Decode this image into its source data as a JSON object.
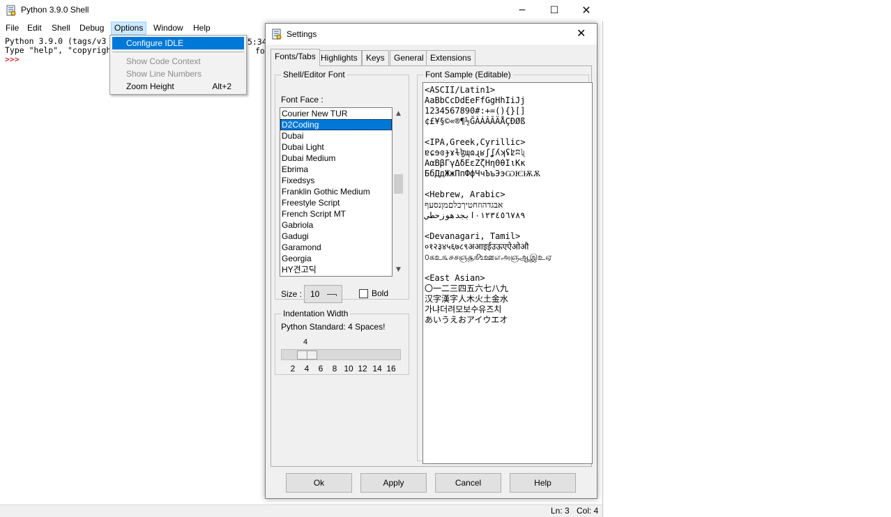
{
  "shell": {
    "title": "Python 3.9.0 Shell",
    "controls": {
      "minimize": "─",
      "maximize": "☐",
      "close": "✕"
    },
    "menu": [
      "File",
      "Edit",
      "Shell",
      "Debug",
      "Options",
      "Window",
      "Help"
    ],
    "text_line1": "Python 3.9.0 (tags/v3",
    "text_line1_tail": "5:34",
    "text_line2": "Type \"help\", \"copyrigh",
    "text_line2_tail": "fo",
    "prompt": ">>>",
    "options_menu": {
      "items": [
        "Configure IDLE",
        "Show Code Context",
        "Show Line Numbers",
        "Zoom Height"
      ],
      "zoom_accel": "Alt+2"
    },
    "status": {
      "ln": "Ln: 3",
      "col": "Col: 4"
    }
  },
  "settings": {
    "title": "Settings",
    "close": "✕",
    "tabs": [
      "Fonts/Tabs",
      "Highlights",
      "Keys",
      "General",
      "Extensions"
    ],
    "font_group_label": "Shell/Editor Font",
    "font_face_label": "Font Face :",
    "fonts": [
      "Courier New TUR",
      "D2Coding",
      "Dubai",
      "Dubai Light",
      "Dubai Medium",
      "Ebrima",
      "Fixedsys",
      "Franklin Gothic Medium",
      "Freestyle Script",
      "French Script MT",
      "Gabriola",
      "Gadugi",
      "Garamond",
      "Georgia",
      "HY견고딕"
    ],
    "selected_font": "D2Coding",
    "size_label": "Size :",
    "size_value": "10",
    "bold_label": "Bold",
    "bold_checked": false,
    "indent_group_label": "Indentation Width",
    "indent_standard": "Python Standard: 4 Spaces!",
    "indent_value": "4",
    "indent_ticks": [
      "2",
      "4",
      "6",
      "8",
      "10",
      "12",
      "14",
      "16"
    ],
    "sample_group_label": "Font Sample (Editable)",
    "sample_text": "<ASCII/Latin1>\nAaBbCcDdEeFfGgHhIiJj\n1234567890#:+=(){}[]\n¢£¥§©«®¶½ĞÀÁÂÃÄÅÇÐØß\n\n<IPA,Greek,Cyrillic>\nɐɕɘɞɟɤɫɮɰɷɻʁʃʆʎʞʢʫʭʯ\nΑαΒβΓγΔδΕεΖζΗηΘθΙιΚκ\nБбДдЖжПпФфЧчЪъЭэѠѤѬѪ\n\n<Hebrew, Arabic>\nאבגדהוזחטיךכלםמןנסעף\n٠١٢٣٤٥٦٧٨٩ابجدهوزحطي\n\n<Devanagari, Tamil>\n०१२३४५६७८९अआइईउऊएऐओऔ\n௦கஉ௩௪சஞ௲௺ஊஎஅஞஆஇஉஏ\n\n<East Asian>\n〇一二三四五六七八九\n汉字漢字人木火土金水\n가냐더려모보수유즈치\nあいうえおアイウエオ",
    "buttons": {
      "ok": "Ok",
      "apply": "Apply",
      "cancel": "Cancel",
      "help": "Help"
    }
  }
}
